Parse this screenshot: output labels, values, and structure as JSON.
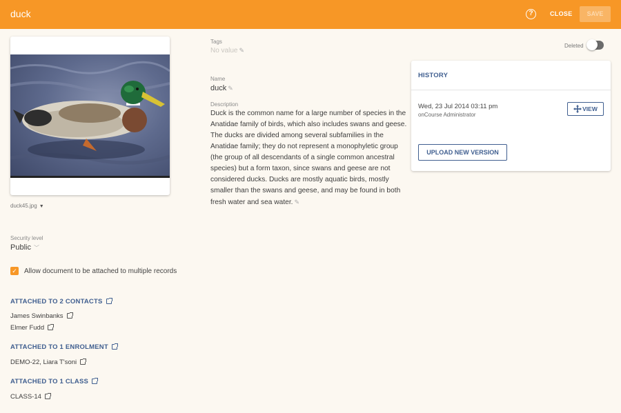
{
  "header": {
    "title": "duck",
    "close_label": "CLOSE",
    "save_label": "SAVE",
    "help_icon": "help-circle-icon",
    "accent_color": "#f79726"
  },
  "document": {
    "filename": "duck45.jpg",
    "tags_label": "Tags",
    "tags_value": "No value",
    "name_label": "Name",
    "name_value": "duck",
    "description_label": "Description",
    "description_value": "Duck is the common name for a large number of species in the Anatidae family of birds, which also includes swans and geese. The ducks are divided among several subfamilies in the Anatidae family; they do not represent a monophyletic group (the group of all descendants of a single common ancestral species) but a form taxon, since swans and geese are not considered ducks. Ducks are mostly aquatic birds, mostly smaller than the swans and geese, and may be found in both fresh water and sea water."
  },
  "security": {
    "label": "Security level",
    "value": "Public"
  },
  "allow_multiple": {
    "label": "Allow document to be attached to multiple records",
    "checked": true
  },
  "attachments": {
    "contacts_heading": "ATTACHED TO 2 CONTACTS",
    "contacts": [
      "James Swinbanks",
      "Elmer Fudd"
    ],
    "enrolment_heading": "ATTACHED TO 1 ENROLMENT",
    "enrolments": [
      "DEMO-22, Liara T'soni"
    ],
    "class_heading": "ATTACHED TO 1 CLASS",
    "classes": [
      "CLASS-14"
    ]
  },
  "deleted": {
    "label": "Deleted",
    "on": false
  },
  "history": {
    "title": "HISTORY",
    "entry_date": "Wed, 23 Jul 2014 03:11 pm",
    "entry_user": "onCourse Administrator",
    "view_label": "VIEW",
    "upload_label": "UPLOAD NEW VERSION"
  }
}
